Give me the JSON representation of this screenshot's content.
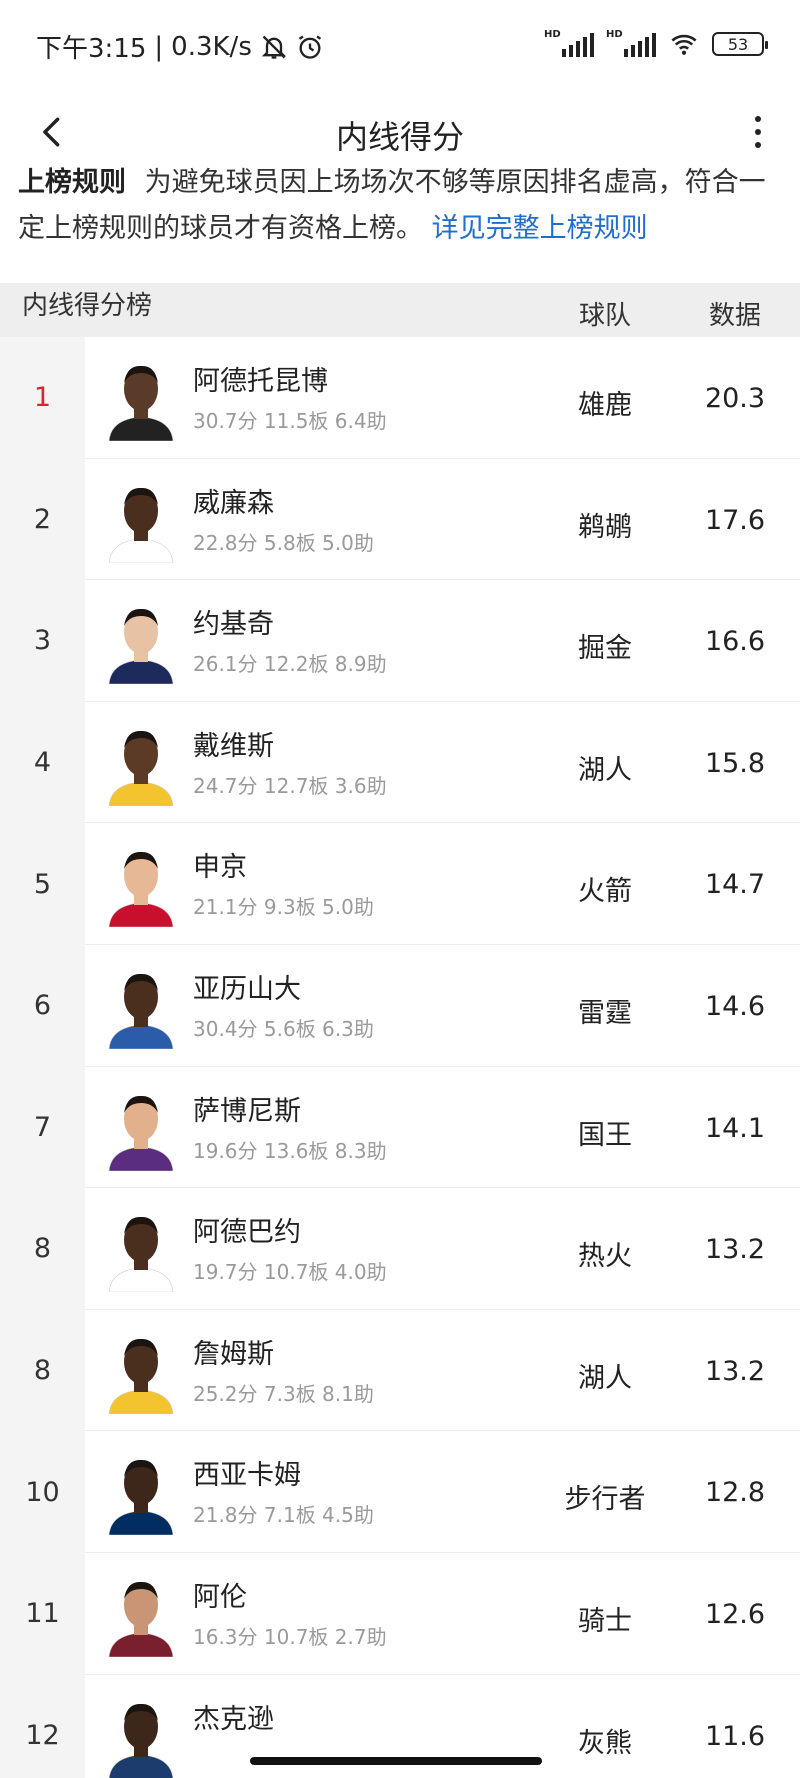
{
  "status_bar": {
    "time": "下午3:15",
    "network_speed": "0.3K/s",
    "separator": "|",
    "signal1_label": "HD",
    "signal2_label": "HD",
    "battery": "53"
  },
  "header": {
    "title": "内线得分",
    "back_icon": "chevron-left-icon",
    "more_icon": "more-vertical-icon"
  },
  "rule": {
    "label": "上榜规则",
    "text": "为避免球员因上场场次不够等原因排名虚高，符合一定上榜规则的球员才有资格上榜。",
    "link": "详见完整上榜规则"
  },
  "table": {
    "title": "内线得分榜",
    "col_team": "球队",
    "col_data": "数据",
    "rows": [
      {
        "rank": "1",
        "name": "阿德托昆博",
        "stats": "30.7分  11.5板  6.4助",
        "team": "雄鹿",
        "value": "20.3"
      },
      {
        "rank": "2",
        "name": "威廉森",
        "stats": "22.8分  5.8板  5.0助",
        "team": "鹈鹕",
        "value": "17.6"
      },
      {
        "rank": "3",
        "name": "约基奇",
        "stats": "26.1分  12.2板  8.9助",
        "team": "掘金",
        "value": "16.6"
      },
      {
        "rank": "4",
        "name": "戴维斯",
        "stats": "24.7分  12.7板  3.6助",
        "team": "湖人",
        "value": "15.8"
      },
      {
        "rank": "5",
        "name": "申京",
        "stats": "21.1分  9.3板  5.0助",
        "team": "火箭",
        "value": "14.7"
      },
      {
        "rank": "6",
        "name": "亚历山大",
        "stats": "30.4分  5.6板  6.3助",
        "team": "雷霆",
        "value": "14.6"
      },
      {
        "rank": "7",
        "name": "萨博尼斯",
        "stats": "19.6分  13.6板  8.3助",
        "team": "国王",
        "value": "14.1"
      },
      {
        "rank": "8",
        "name": "阿德巴约",
        "stats": "19.7分  10.7板  4.0助",
        "team": "热火",
        "value": "13.2"
      },
      {
        "rank": "8",
        "name": "詹姆斯",
        "stats": "25.2分  7.3板  8.1助",
        "team": "湖人",
        "value": "13.2"
      },
      {
        "rank": "10",
        "name": "西亚卡姆",
        "stats": "21.8分  7.1板  4.5助",
        "team": "步行者",
        "value": "12.8"
      },
      {
        "rank": "11",
        "name": "阿伦",
        "stats": "16.3分  10.7板  2.7助",
        "team": "骑士",
        "value": "12.6"
      },
      {
        "rank": "12",
        "name": "杰克逊",
        "stats": "",
        "team": "灰熊",
        "value": "11.6"
      }
    ]
  },
  "colors": {
    "accent_red": "#d8262e",
    "link_blue": "#1f6fd1",
    "jerseys": [
      "#222222",
      "#ffffff",
      "#1d2a5c",
      "#f4c430",
      "#c8102e",
      "#2a5caa",
      "#5a2d81",
      "#ffffff",
      "#f4c430",
      "#002d62",
      "#7a1f2e",
      "#1d3c6e"
    ],
    "skin": [
      "#5a3a28",
      "#4a2e1e",
      "#e8c2a4",
      "#5b3a26",
      "#e6b896",
      "#4a2e1e",
      "#e2b08c",
      "#4a2e1e",
      "#4a2e1e",
      "#3d261a",
      "#c99574",
      "#3d261a"
    ]
  }
}
